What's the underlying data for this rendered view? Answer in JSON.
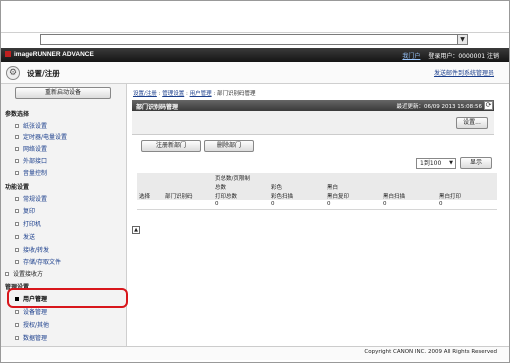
{
  "header": {
    "brand": "imageRUNNER ADVANCE",
    "my_portal": "我门户",
    "login_user": "登录用户：0000001 注销"
  },
  "subheader": {
    "title": "设置/注册",
    "send_link": "发送邮件到系统管理员"
  },
  "sidebar": {
    "restart_label": "重新启动设备",
    "sections": [
      {
        "title": "参数选择",
        "items": [
          "纸张设置",
          "定时器/电量设置",
          "网络设置",
          "外部接口",
          "音量控制"
        ]
      },
      {
        "title": "功能设置",
        "items": [
          "常规设置",
          "复印",
          "打印机",
          "发送",
          "接收/转发",
          "存储/存取文件"
        ]
      },
      {
        "title": "设置接收方",
        "items": []
      },
      {
        "title": "管理设置",
        "items": [
          "用户管理",
          "设备管理",
          "授权/其他",
          "数据管理"
        ]
      }
    ]
  },
  "main": {
    "breadcrumb": [
      "设置/注册",
      "管理设置",
      "用户管理",
      "部门识别码管理"
    ],
    "panel_title": "部门识别码管理",
    "last_update": "最近更新：06/09 2013 15:08:56",
    "settings_btn": "设置...",
    "register_btn": "注册新部门",
    "delete_btn": "删除部门",
    "page_select": "1到100",
    "display_btn": "显示",
    "table": {
      "page_limit_header": "页总数/页限制",
      "total": "总数",
      "color": "彩色",
      "bw": "黑白",
      "columns": [
        "选择",
        "部门识别码",
        "打印总数",
        "彩色扫描",
        "黑白复印",
        "黑白扫描",
        "黑白打印"
      ],
      "zero": "0"
    }
  },
  "footer": {
    "copyright": "Copyright CANON INC. 2009 All Rights Reserved"
  }
}
